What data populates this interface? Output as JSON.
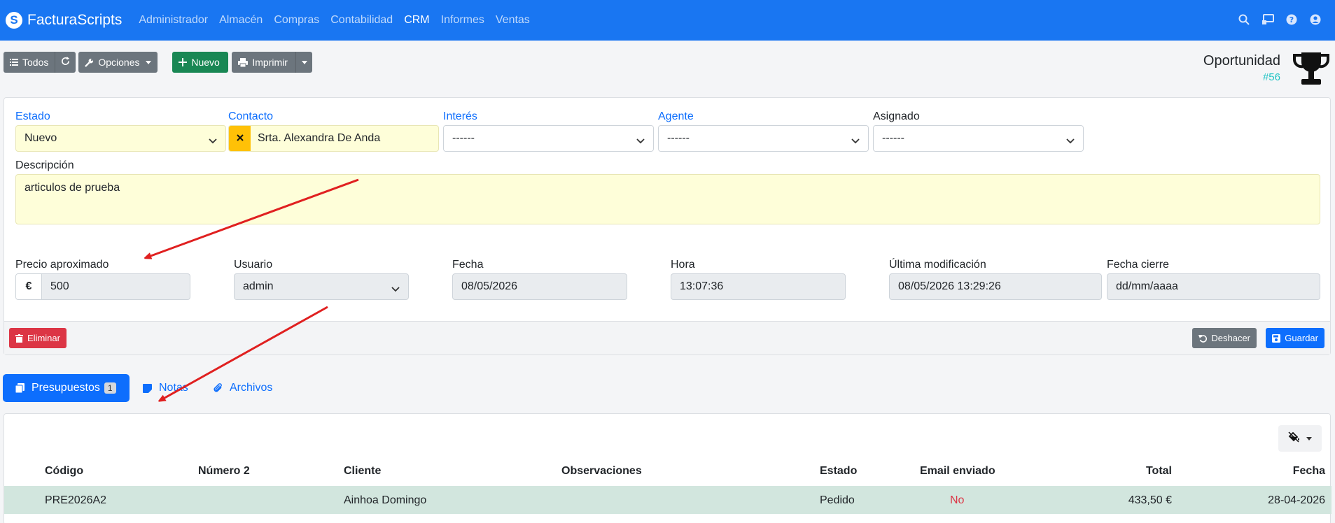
{
  "navbar": {
    "brand": "FacturaScripts",
    "brand_letter": "S",
    "links": [
      "Administrador",
      "Almacén",
      "Compras",
      "Contabilidad",
      "CRM",
      "Informes",
      "Ventas"
    ],
    "active": "CRM",
    "icons": [
      "search-icon",
      "monitor-icon",
      "help-icon",
      "user-icon"
    ]
  },
  "toolbar": {
    "all_label": "Todos",
    "options_label": "Opciones",
    "new_label": "Nuevo",
    "print_label": "Imprimir"
  },
  "title": {
    "main": "Oportunidad",
    "sub": "#56"
  },
  "form": {
    "estado": {
      "label": "Estado",
      "value": "Nuevo"
    },
    "contacto": {
      "label": "Contacto",
      "value": "Srta. Alexandra De Anda"
    },
    "interes": {
      "label": "Interés",
      "value": "------"
    },
    "agente": {
      "label": "Agente",
      "value": "------"
    },
    "asignado": {
      "label": "Asignado",
      "value": "------"
    },
    "descripcion": {
      "label": "Descripción",
      "value": "articulos de prueba"
    },
    "precio": {
      "label": "Precio aproximado",
      "currency": "€",
      "value": "500"
    },
    "usuario": {
      "label": "Usuario",
      "value": "admin"
    },
    "fecha": {
      "label": "Fecha",
      "value": "08/05/2026"
    },
    "hora": {
      "label": "Hora",
      "value": "13:07:36"
    },
    "ultima": {
      "label": "Última modificación",
      "value": "08/05/2026 13:29:26"
    },
    "cierre": {
      "label": "Fecha cierre",
      "value": "dd/mm/aaaa"
    }
  },
  "footer": {
    "delete_label": "Eliminar",
    "undo_label": "Deshacer",
    "save_label": "Guardar"
  },
  "tabs": {
    "presupuestos": "Presupuestos",
    "presupuestos_count": "1",
    "notas": "Notas",
    "archivos": "Archivos"
  },
  "table": {
    "headers": [
      "Código",
      "Número 2",
      "Cliente",
      "Observaciones",
      "Estado",
      "Email enviado",
      "Total",
      "Fecha"
    ],
    "rows": [
      {
        "codigo": "PRE2026A2",
        "numero2": "",
        "cliente": "Ainhoa Domingo",
        "observaciones": "",
        "estado": "Pedido",
        "email": "No",
        "total": "433,50 €",
        "fecha": "28-04-2026"
      }
    ]
  },
  "colors": {
    "navbar": "#1976f2",
    "primary": "#0d6efd",
    "success": "#198754",
    "danger": "#dc3545",
    "secondary": "#6c757d",
    "highlight_row": "#d2e6de",
    "annotation_arrow": "#e02020"
  }
}
